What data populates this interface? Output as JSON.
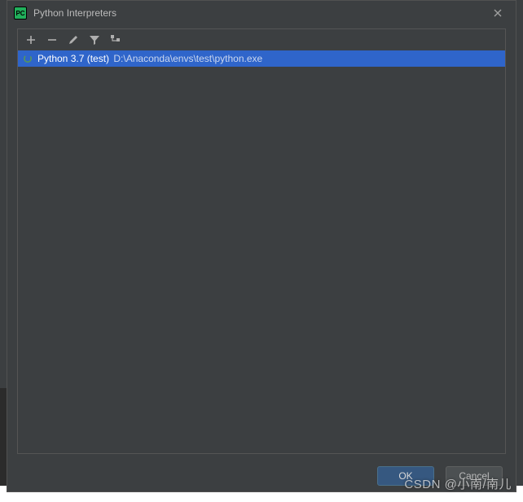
{
  "dialog": {
    "title": "Python Interpreters",
    "app_icon_text": "PC"
  },
  "toolbar": {
    "add": "add-icon",
    "remove": "remove-icon",
    "edit": "edit-icon",
    "filter": "filter-icon",
    "show_paths": "show-paths-icon"
  },
  "interpreters": [
    {
      "name": "Python 3.7 (test)",
      "path": "D:\\Anaconda\\envs\\test\\python.exe",
      "selected": true,
      "loading": true
    }
  ],
  "buttons": {
    "ok": "OK",
    "cancel": "Cancel"
  },
  "watermark": "CSDN @小南/南儿"
}
